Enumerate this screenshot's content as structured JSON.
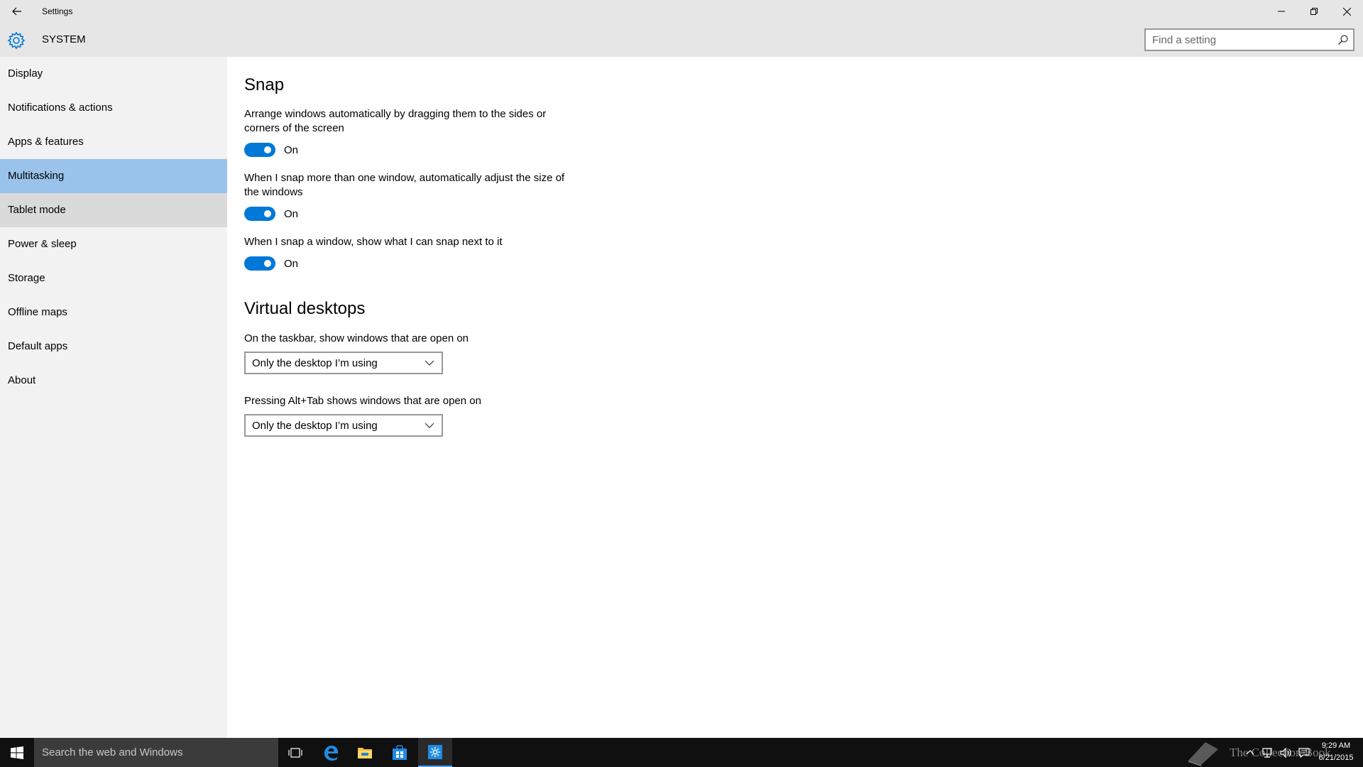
{
  "window": {
    "title": "Settings",
    "minimize_icon": "minimize-icon",
    "maximize_icon": "restore-icon",
    "close_icon": "close-icon"
  },
  "header": {
    "section_title": "SYSTEM",
    "icon": "gear-icon",
    "search_placeholder": "Find a setting"
  },
  "sidebar": {
    "items": [
      {
        "label": "Display",
        "state": "normal"
      },
      {
        "label": "Notifications & actions",
        "state": "normal"
      },
      {
        "label": "Apps & features",
        "state": "normal"
      },
      {
        "label": "Multitasking",
        "state": "selected"
      },
      {
        "label": "Tablet mode",
        "state": "hover"
      },
      {
        "label": "Power & sleep",
        "state": "normal"
      },
      {
        "label": "Storage",
        "state": "normal"
      },
      {
        "label": "Offline maps",
        "state": "normal"
      },
      {
        "label": "Default apps",
        "state": "normal"
      },
      {
        "label": "About",
        "state": "normal"
      }
    ]
  },
  "snap": {
    "heading": "Snap",
    "settings": [
      {
        "description": "Arrange windows automatically by dragging them to the sides or corners of the screen",
        "state": "On"
      },
      {
        "description": "When I snap more than one window, automatically adjust the size of the windows",
        "state": "On"
      },
      {
        "description": "When I snap a window, show what I can snap next to it",
        "state": "On"
      }
    ]
  },
  "virtual_desktops": {
    "heading": "Virtual desktops",
    "settings": [
      {
        "label": "On the taskbar, show windows that are open on",
        "selected": "Only the desktop I’m using"
      },
      {
        "label": "Pressing Alt+Tab shows windows that are open on",
        "selected": "Only the desktop I’m using"
      }
    ]
  },
  "taskbar": {
    "search_text": "Search the web and Windows",
    "watermark_text": "The Collection Book",
    "clock_time": "9:29 AM",
    "clock_date": "6/21/2015",
    "colors": {
      "background": "#101010",
      "search_box": "#3b3b3b",
      "accent": "#0078d7"
    }
  },
  "colors": {
    "accent": "#0078d7",
    "selected_nav": "#99c3eb",
    "hover_nav": "#dadada",
    "chrome": "#e6e6e6",
    "sidebar": "#f2f2f2"
  }
}
